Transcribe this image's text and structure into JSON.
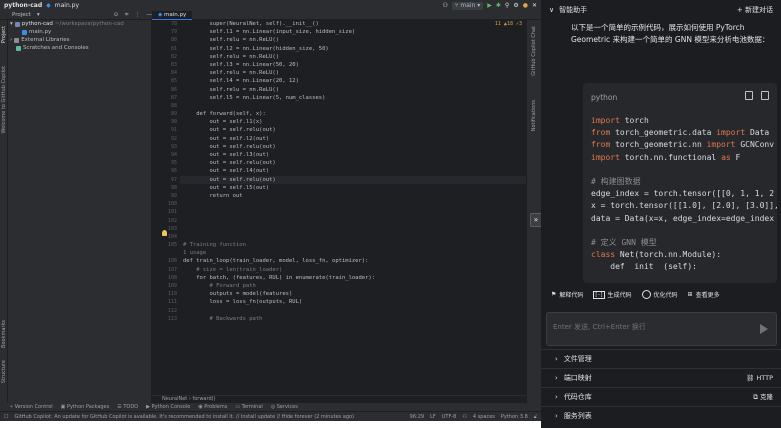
{
  "title_bar": {
    "project": "python-cad",
    "file": "main.py",
    "branch": "main"
  },
  "toolbar": {
    "project_label": "Project",
    "tab": "main.py"
  },
  "tool_windows_left": [
    "Project",
    "Welcome to GitHub Copilot",
    "Bookmarks",
    "Structure"
  ],
  "tool_windows_right": [
    "GitHub Copilot Chat",
    "Notifications"
  ],
  "project_tree": [
    {
      "label": "python-cad",
      "hint": "~/workspace/python-cad",
      "indent": 0,
      "type": "folder"
    },
    {
      "label": "main.py",
      "hint": "",
      "indent": 1,
      "type": "file"
    },
    {
      "label": "External Libraries",
      "hint": "",
      "indent": 0,
      "type": "lib"
    },
    {
      "label": "Scratches and Consoles",
      "hint": "",
      "indent": 0,
      "type": "scratch"
    }
  ],
  "editor": {
    "inspection": "11 ▲18 ✓3",
    "current_line": 7,
    "lines": [
      {
        "n": "",
        "t": "        super(NeuralNet, self).__init__()"
      },
      {
        "n": "",
        "t": "        self.l1 = nn.Linear(input_size, hidden_size)"
      },
      {
        "n": "",
        "t": "        self.relu = nn.ReLU()"
      },
      {
        "n": "",
        "t": "        self.l2 = nn.Linear(hidden_size, 50)"
      },
      {
        "n": "",
        "t": "        self.relu = nn.ReLU()"
      },
      {
        "n": "",
        "t": "        self.l3 = nn.Linear(50, 20)"
      },
      {
        "n": "",
        "t": "        self.relu = nn.ReLU()"
      },
      {
        "n": "",
        "t": "        self.l4 = nn.Linear(20, 12)"
      },
      {
        "n": "",
        "t": "        self.relu = nn.ReLU()"
      },
      {
        "n": "",
        "t": "        self.l5 = nn.Linear(5, num_classes)"
      },
      {
        "n": "",
        "t": ""
      },
      {
        "n": "",
        "t": "    def forward(self, x):"
      },
      {
        "n": "",
        "t": "        out = self.l1(x)"
      },
      {
        "n": "",
        "t": "        out = self.relu(out)"
      },
      {
        "n": "",
        "t": "        out = self.l2(out)"
      },
      {
        "n": "",
        "t": "        out = self.relu(out)"
      },
      {
        "n": "",
        "t": "        out = self.l3(out)"
      },
      {
        "n": "",
        "t": "        out = self.relu(out)"
      },
      {
        "n": "",
        "t": "        out = self.l4(out)"
      },
      {
        "n": "",
        "t": "        out = self.relu(out)"
      },
      {
        "n": "",
        "t": "        out = self.l5(out)"
      },
      {
        "n": "",
        "t": "        return out"
      },
      {
        "n": "",
        "t": ""
      },
      {
        "n": "",
        "t": ""
      },
      {
        "n": "",
        "t": ""
      },
      {
        "n": "",
        "t": ""
      },
      {
        "n": "",
        "t": ""
      },
      {
        "n": "",
        "t": "# Training function"
      },
      {
        "n": "",
        "t": "1 usage"
      },
      {
        "n": "",
        "t": "def train_loop(train_loader, model, loss_fn, optimizer):"
      },
      {
        "n": "",
        "t": "    # size = len(train_loader)"
      },
      {
        "n": "",
        "t": "    for batch, (features, RUL) in enumerate(train_loader):"
      },
      {
        "n": "",
        "t": "        # Forward path"
      },
      {
        "n": "",
        "t": "        outputs = model(features)"
      },
      {
        "n": "",
        "t": "        loss = loss_fn(outputs, RUL)"
      },
      {
        "n": "",
        "t": ""
      },
      {
        "n": "",
        "t": "        # Backwards path"
      }
    ],
    "gutter": [
      "78",
      "79",
      "80",
      "81",
      "82",
      "83",
      "84",
      "85",
      "86",
      "87",
      "88",
      "89",
      "90",
      "91",
      "92",
      "93",
      "94",
      "95",
      "96",
      "97",
      "98",
      "99",
      "100",
      "101",
      "102",
      "103",
      "104",
      "105",
      "",
      "106",
      "107",
      "108",
      "109",
      "110",
      "111",
      "112",
      "113"
    ]
  },
  "breadcrumb": [
    "NeuralNet",
    "forward()"
  ],
  "bottom_tools": [
    "Version Control",
    "Python Packages",
    "TODO",
    "Python Console",
    "Problems",
    "Terminal",
    "Services"
  ],
  "status": {
    "message": "GitHub Copilot: An update for GitHub Copilot is available. It's recommended to install it. // Install update // Hide forever (2 minutes ago)",
    "position": "96:29",
    "line_sep": "LF",
    "encoding": "UTF-8",
    "indent": "4 spaces",
    "interpreter": "Python 3.8"
  },
  "ai_panel": {
    "title": "智能助手",
    "new_chat": "+ 新建对话",
    "intro": "以下是一个简单的示例代码，展示如何使用 PyTorch Geometric 来构建一个简单的 GNN 模型来分析电池数据：",
    "code_lang": "python",
    "code": [
      {
        "k": "import",
        "r": " torch"
      },
      {
        "k": "from",
        "r": " torch_geometric.data ",
        "k2": "import",
        "r2": " Data"
      },
      {
        "k": "from",
        "r": " torch_geometric.nn ",
        "k2": "import",
        "r2": " GCNConv"
      },
      {
        "k": "import",
        "r": " torch.nn.functional ",
        "k2": "as",
        "r2": " F"
      },
      {
        "k": "",
        "r": ""
      },
      {
        "c": "# 构建图数据"
      },
      {
        "k": "",
        "r": "edge_index = torch.tensor([[0, 1, 1, 2"
      },
      {
        "k": "",
        "r": "x = torch.tensor([[1.0], [2.0], [3.0]],"
      },
      {
        "k": "",
        "r": "data = Data(x=x, edge_index=edge_index"
      },
      {
        "k": "",
        "r": ""
      },
      {
        "c": "# 定义 GNN 模型"
      },
      {
        "k": "class",
        "r": " Net(torch.nn.Module):"
      },
      {
        "k": "",
        "r": "    def  init  (self):"
      }
    ],
    "actions": [
      "解释代码",
      "生成代码",
      "优化代码",
      "查看更多"
    ],
    "input_placeholder": "Enter 发送, Ctrl+Enter 换行",
    "sections": [
      {
        "label": "文件管理",
        "right": ""
      },
      {
        "label": "端口映射",
        "right": "HTTP"
      },
      {
        "label": "代码仓库",
        "right": "克隆"
      },
      {
        "label": "服务列表",
        "right": ""
      }
    ]
  }
}
